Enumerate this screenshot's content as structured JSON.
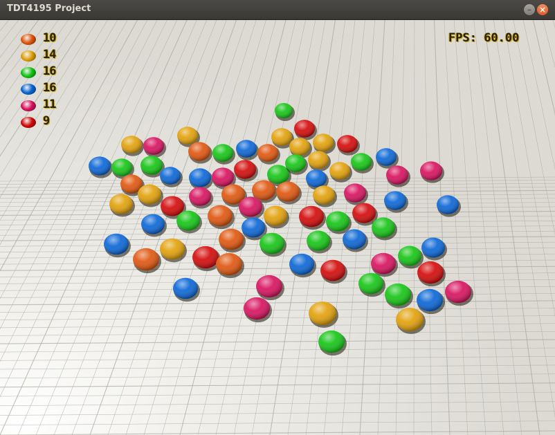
{
  "window": {
    "title": "TDT4195 Project",
    "minimize_glyph": "–",
    "close_glyph": "×"
  },
  "colors": {
    "orange": "#e0560e",
    "yellow": "#e2a10a",
    "green": "#15c515",
    "blue": "#0a66d6",
    "pink": "#d8125f",
    "red": "#d40a0a",
    "floor": "#e8e6e0",
    "grid_line": "#a8a69f"
  },
  "legend": [
    {
      "color": "orange",
      "count": "10"
    },
    {
      "color": "yellow",
      "count": "14"
    },
    {
      "color": "green",
      "count": "16"
    },
    {
      "color": "blue",
      "count": "16"
    },
    {
      "color": "pink",
      "count": "11"
    },
    {
      "color": "red",
      "count": "9"
    }
  ],
  "fps": {
    "label": "FPS:",
    "value": "60.00"
  }
}
